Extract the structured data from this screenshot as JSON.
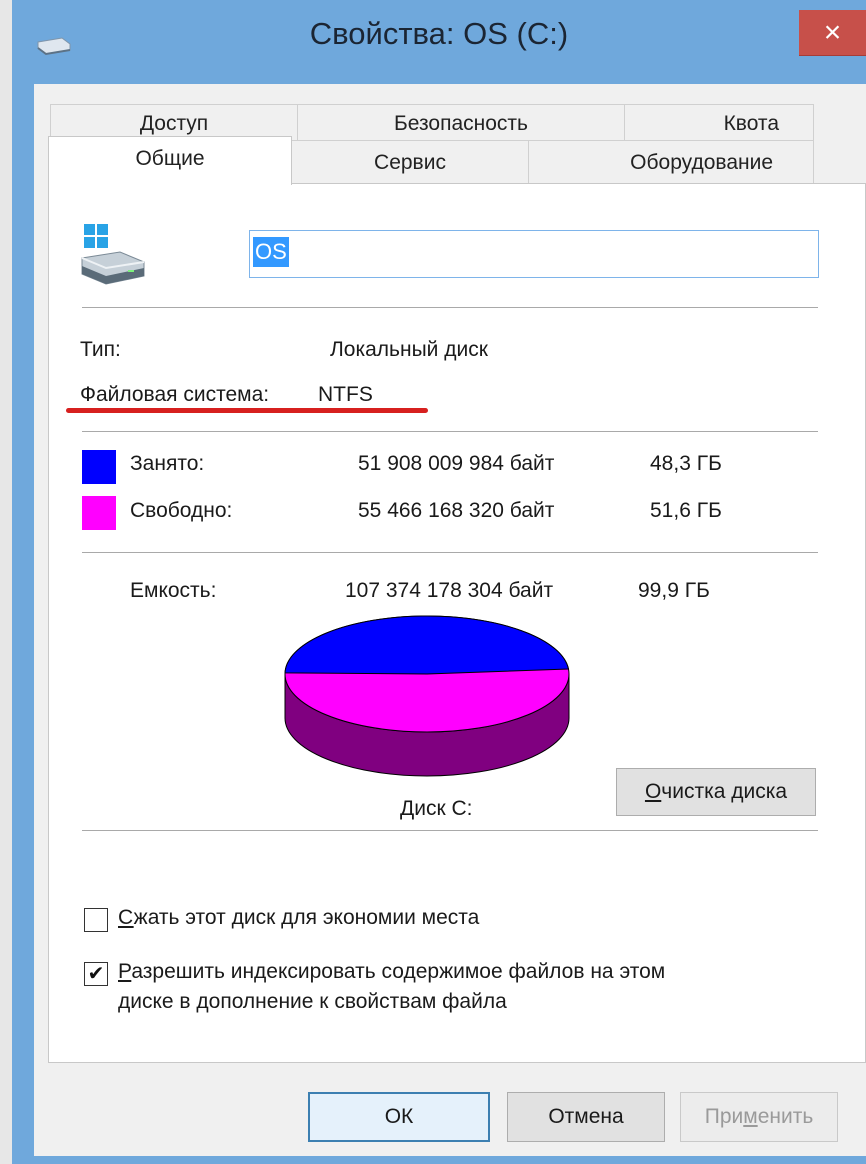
{
  "window": {
    "title": "Свойства: OS (C:)",
    "close_label": "×"
  },
  "tabs": {
    "row1": [
      "Доступ",
      "Безопасность",
      "Квота"
    ],
    "row2": [
      "Общие",
      "Сервис",
      "Оборудование"
    ]
  },
  "general": {
    "drive_name": "OS",
    "type_label": "Тип:",
    "type_value": "Локальный диск",
    "fs_label": "Файловая система:",
    "fs_value": "NTFS",
    "used_label": "Занято:",
    "used_bytes": "51 908 009 984 байт",
    "used_size": "48,3 ГБ",
    "used_color": "#0000ff",
    "free_label": "Свободно:",
    "free_bytes": "55 466 168 320 байт",
    "free_size": "51,6 ГБ",
    "free_color": "#ff00ff",
    "capacity_label": "Емкость:",
    "capacity_bytes": "107 374 178 304 байт",
    "capacity_size": "99,9 ГБ",
    "disk_label": "Диск C:",
    "cleanup_button": {
      "pre": "",
      "key": "О",
      "post": "чистка диска"
    },
    "used_fraction": 0.483
  },
  "options": {
    "compress": {
      "key": "С",
      "rest": "жать этот диск для экономии места",
      "checked": false
    },
    "index": {
      "key": "Р",
      "rest": "азрешить индексировать содержимое файлов на этом",
      "line2": "диске в дополнение к свойствам файла",
      "checked": true,
      "check_glyph": "✔"
    }
  },
  "buttons": {
    "ok": "ОК",
    "cancel": "Отмена",
    "apply": {
      "pre": "При",
      "key": "м",
      "post": "енить"
    }
  },
  "icons": {
    "app": "drive-icon",
    "drive": "windows-drive-icon"
  }
}
